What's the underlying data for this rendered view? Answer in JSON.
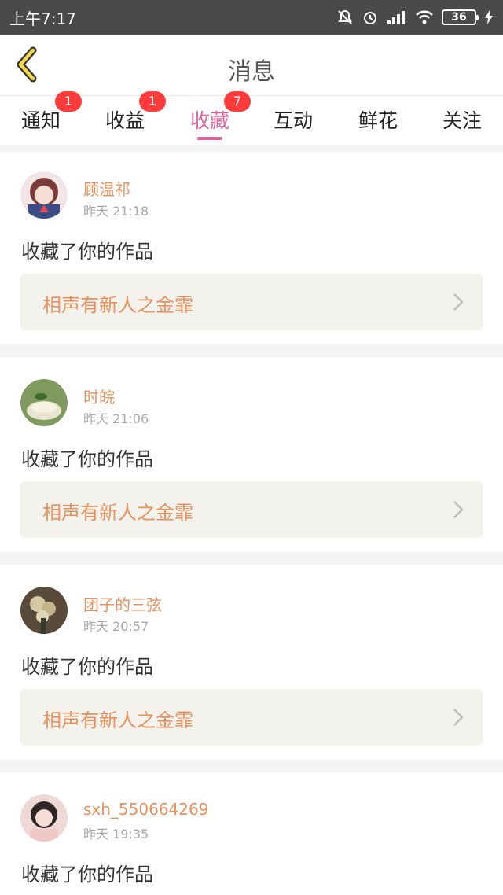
{
  "status_bar": {
    "time": "上午7:17",
    "battery": "36"
  },
  "header": {
    "title": "消息"
  },
  "tabs": [
    {
      "label": "通知",
      "badge": "1"
    },
    {
      "label": "收益",
      "badge": "1"
    },
    {
      "label": "收藏",
      "badge": "7"
    },
    {
      "label": "互动",
      "badge": ""
    },
    {
      "label": "鲜花",
      "badge": ""
    },
    {
      "label": "关注",
      "badge": ""
    }
  ],
  "active_tab": 2,
  "colors": {
    "accent": "#e0609a",
    "username": "#e8915e",
    "badge": "#ff3b3b"
  },
  "notifications": [
    {
      "username": "顾温祁",
      "time": "昨天 21:18",
      "action": "收藏了你的作品",
      "work": "相声有新人之金霏"
    },
    {
      "username": "时皖",
      "time": "昨天 21:06",
      "action": "收藏了你的作品",
      "work": "相声有新人之金霏"
    },
    {
      "username": "团子的三弦",
      "time": "昨天 20:57",
      "action": "收藏了你的作品",
      "work": "相声有新人之金霏"
    },
    {
      "username": "sxh_550664269",
      "time": "昨天 19:35",
      "action": "收藏了你的作品",
      "work": ""
    }
  ]
}
